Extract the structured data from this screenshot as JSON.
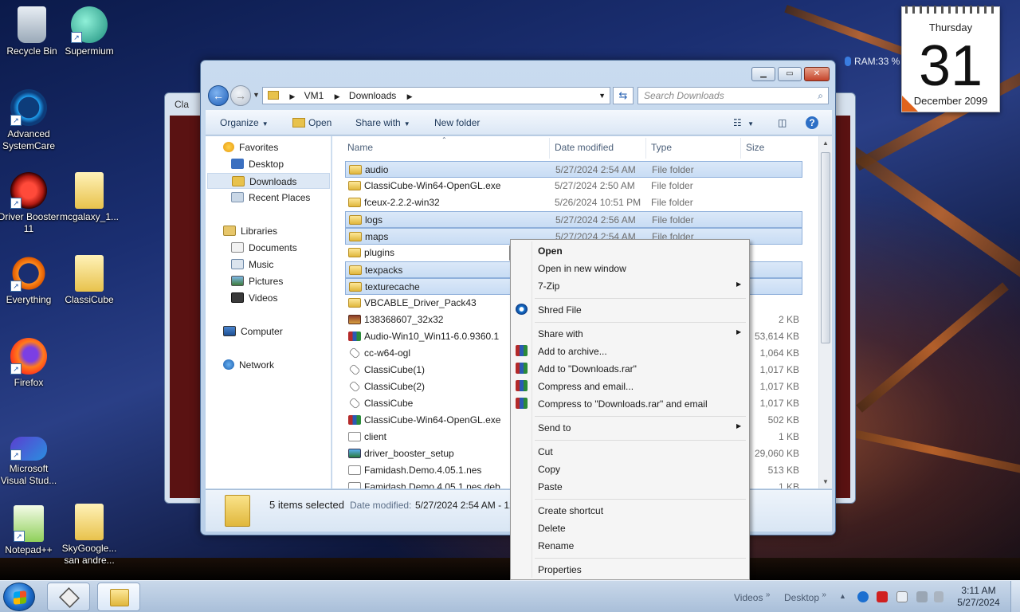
{
  "desktop": {
    "icons": [
      {
        "label": "Recycle Bin"
      },
      {
        "label": "Supermium"
      },
      {
        "label": "Advanced SystemCare"
      },
      {
        "label": "Driver Booster 11"
      },
      {
        "label": "mcgalaxy_1..."
      },
      {
        "label": "Everything"
      },
      {
        "label": "ClassiCube"
      },
      {
        "label": "Firefox"
      },
      {
        "label": "Microsoft Visual Stud..."
      },
      {
        "label": "Notepad++"
      },
      {
        "label": "SkyGoogle... san andre..."
      }
    ],
    "ram_gadget": "RAM:33 %",
    "calendar": {
      "weekday": "Thursday",
      "day": "31",
      "month_year": "December 2099"
    },
    "background_window_title": "Cla"
  },
  "explorer": {
    "address": {
      "root": "VM1",
      "folder": "Downloads"
    },
    "search_placeholder": "Search Downloads",
    "toolbar": {
      "organize": "Organize",
      "open": "Open",
      "share_with": "Share with",
      "new_folder": "New folder"
    },
    "nav": {
      "favorites": "Favorites",
      "desktop": "Desktop",
      "downloads": "Downloads",
      "recent_places": "Recent Places",
      "libraries": "Libraries",
      "documents": "Documents",
      "music": "Music",
      "pictures": "Pictures",
      "videos": "Videos",
      "computer": "Computer",
      "network": "Network"
    },
    "columns": {
      "name": "Name",
      "date": "Date modified",
      "type": "Type",
      "size": "Size"
    },
    "files": [
      {
        "name": "audio",
        "date": "5/27/2024 2:54 AM",
        "type": "File folder",
        "size": "",
        "selected": true,
        "kind": "folder"
      },
      {
        "name": "ClassiCube-Win64-OpenGL.exe",
        "date": "5/27/2024 2:50 AM",
        "type": "File folder",
        "size": "",
        "selected": false,
        "kind": "folder"
      },
      {
        "name": "fceux-2.2.2-win32",
        "date": "5/26/2024 10:51 PM",
        "type": "File folder",
        "size": "",
        "selected": false,
        "kind": "folder"
      },
      {
        "name": "logs",
        "date": "5/27/2024 2:56 AM",
        "type": "File folder",
        "size": "",
        "selected": true,
        "kind": "folder"
      },
      {
        "name": "maps",
        "date": "5/27/2024 2:54 AM",
        "type": "File folder",
        "size": "",
        "selected": true,
        "kind": "folder"
      },
      {
        "name": "plugins",
        "date": "",
        "type": "",
        "size": "",
        "selected": false,
        "kind": "folder"
      },
      {
        "name": "texpacks",
        "date": "",
        "type": "",
        "size": "",
        "selected": true,
        "kind": "folder"
      },
      {
        "name": "texturecache",
        "date": "",
        "type": "",
        "size": "",
        "selected": true,
        "kind": "folder"
      },
      {
        "name": "VBCABLE_Driver_Pack43",
        "date": "",
        "type": "",
        "size": "",
        "selected": false,
        "kind": "folder"
      },
      {
        "name": "138368607_32x32",
        "date": "",
        "type": "",
        "size": "2 KB",
        "selected": false,
        "kind": "image"
      },
      {
        "name": "Audio-Win10_Win11-6.0.9360.1",
        "date": "",
        "type": "",
        "size": "53,614 KB",
        "selected": false,
        "kind": "rar"
      },
      {
        "name": "cc-w64-ogl",
        "date": "",
        "type": "",
        "size": "1,064 KB",
        "selected": false,
        "kind": "exe"
      },
      {
        "name": "ClassiCube(1)",
        "date": "",
        "type": "",
        "size": "1,017 KB",
        "selected": false,
        "kind": "exe"
      },
      {
        "name": "ClassiCube(2)",
        "date": "",
        "type": "",
        "size": "1,017 KB",
        "selected": false,
        "kind": "exe"
      },
      {
        "name": "ClassiCube",
        "date": "",
        "type": "",
        "size": "1,017 KB",
        "selected": false,
        "kind": "exe"
      },
      {
        "name": "ClassiCube-Win64-OpenGL.exe",
        "date": "",
        "type": "",
        "size": "502 KB",
        "selected": false,
        "kind": "rar"
      },
      {
        "name": "client",
        "date": "",
        "type": "",
        "size": "1 KB",
        "selected": false,
        "kind": "file"
      },
      {
        "name": "driver_booster_setup",
        "date": "",
        "type": "",
        "size": "29,060 KB",
        "selected": false,
        "kind": "setup"
      },
      {
        "name": "Famidash.Demo.4.05.1.nes",
        "date": "",
        "type": "",
        "size": "513 KB",
        "selected": false,
        "kind": "file"
      },
      {
        "name": "Famidash.Demo.4.05.1.nes.deb",
        "date": "",
        "type": "",
        "size": "1 KB",
        "selected": false,
        "kind": "file"
      }
    ],
    "details": {
      "count": "5 items selected",
      "date_label": "Date modified:",
      "date_value": "5/27/2024 2:54 AM - 12"
    }
  },
  "context_menu": {
    "open": "Open",
    "open_new_window": "Open in new window",
    "seven_zip": "7-Zip",
    "shred": "Shred File",
    "share_with": "Share with",
    "add_archive": "Add to archive...",
    "add_rar": "Add to \"Downloads.rar\"",
    "compress_email": "Compress and email...",
    "compress_rar_email": "Compress to \"Downloads.rar\" and email",
    "send_to": "Send to",
    "cut": "Cut",
    "copy": "Copy",
    "paste": "Paste",
    "create_shortcut": "Create shortcut",
    "delete": "Delete",
    "rename": "Rename",
    "properties": "Properties"
  },
  "taskbar": {
    "toolbar_videos": "Videos",
    "toolbar_desktop": "Desktop",
    "time": "3:11 AM",
    "date": "5/27/2024"
  },
  "colors": {
    "accent": "#1f5fb8",
    "selection": "#cce0f7",
    "folder": "#f0c84a"
  }
}
